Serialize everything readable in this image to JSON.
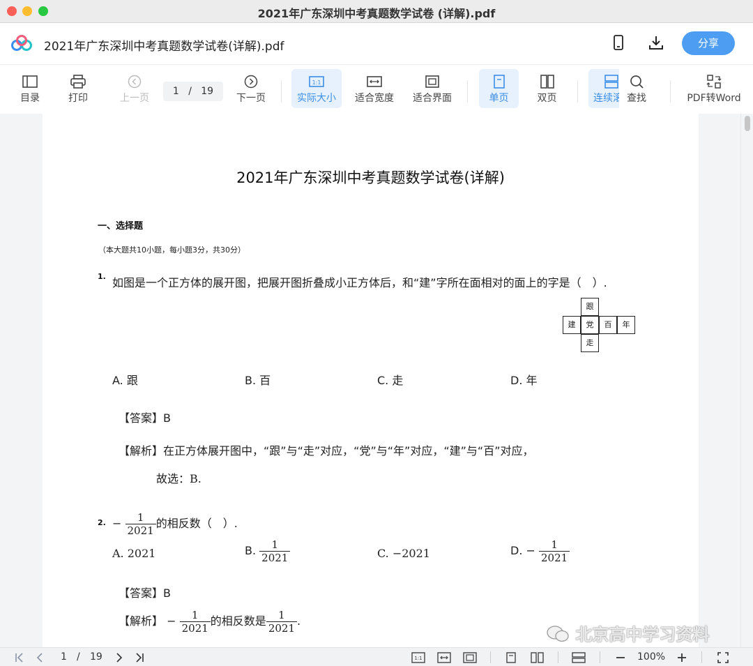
{
  "window": {
    "title": "2021年广东深圳中考真题数学试卷 (详解).pdf"
  },
  "header": {
    "doc_title": "2021年广东深圳中考真题数学试卷(详解).pdf",
    "share_label": "分享"
  },
  "toolbar": {
    "toc": "目录",
    "print": "打印",
    "prev": "上一页",
    "page_current": "1",
    "page_sep": "/",
    "page_total": "19",
    "next": "下一页",
    "actual_size": "实际大小",
    "fit_width": "适合宽度",
    "fit_page": "适合界面",
    "single": "单页",
    "double": "双页",
    "continuous": "连续滚",
    "find": "查找",
    "pdf_word": "PDF转Word"
  },
  "doc": {
    "title": "2021年广东深圳中考真题数学试卷(详解)",
    "section": "一、选择题",
    "section_note": "（本大题共10小题，每小题3分，共30分）",
    "q1": {
      "num": "1.",
      "text": "如图是一个正方体的展开图，把展开图折叠成小正方体后，和“建”字所在面相对的面上的字是（　）.",
      "net": {
        "top": "跟",
        "left": "建",
        "center": "党",
        "right1": "百",
        "right2": "年",
        "bottom": "走"
      },
      "options": [
        "A. 跟",
        "B. 百",
        "C. 走",
        "D. 年"
      ],
      "answer_label": "【答案】",
      "answer": "B",
      "analysis_label": "【解析】",
      "analysis": "在正方体展开图中，“跟”与“走”对应，“党”与“年”对应，“建”与“百”对应，",
      "conclusion": "故选：B."
    },
    "q2": {
      "num": "2.",
      "minus": "−",
      "frac_num": "1",
      "frac_den": "2021",
      "text": "的相反数（　）.",
      "opt_a": "A. 2021",
      "opt_b": "B.",
      "opt_c": "C. −2021",
      "opt_d": "D. −",
      "answer_label": "【答案】",
      "answer": "B",
      "analysis_label": "【解析】",
      "analysis_mid": "的相反数是",
      "analysis_end": "."
    }
  },
  "watermark": "北京高中学习资料",
  "bottom": {
    "page_current": "1",
    "page_sep": "/",
    "page_total": "19",
    "zoom": "100%"
  }
}
